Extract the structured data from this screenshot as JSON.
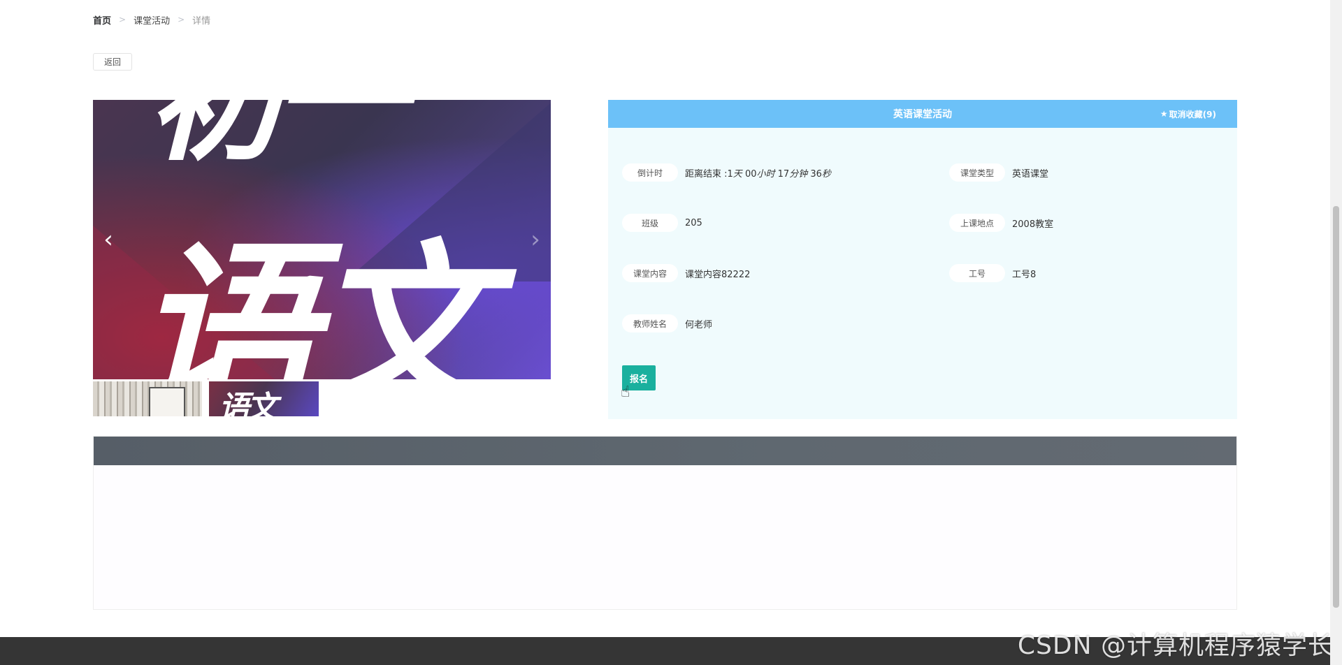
{
  "breadcrumb": {
    "home": "首页",
    "section": "课堂活动",
    "current": "详情",
    "separator": ">"
  },
  "back_label": "返回",
  "carousel": {
    "image_text_top": "初一",
    "image_text_main": "语文",
    "thumb_text": "语文",
    "prev_icon": "chevron-left-icon",
    "next_icon": "chevron-right-icon"
  },
  "detail": {
    "title": "英语课堂活动",
    "favorite_label": "取消收藏(9)",
    "favorite_icon": "star-icon",
    "countdown": {
      "label": "倒计时",
      "prefix": "距离结束 :1",
      "day_unit": "天",
      "hours": " 00",
      "hour_unit": "小时",
      "minutes": " 17",
      "minute_unit": "分钟",
      "seconds": " 36",
      "second_unit": "秒"
    },
    "course_type": {
      "label": "课堂类型",
      "value": "英语课堂"
    },
    "class": {
      "label": "班级",
      "value": "205"
    },
    "location": {
      "label": "上课地点",
      "value": "2008教室"
    },
    "content": {
      "label": "课堂内容",
      "value": "课堂内容82222"
    },
    "staff_no": {
      "label": "工号",
      "value": "工号8"
    },
    "teacher": {
      "label": "教师姓名",
      "value": "何老师"
    },
    "signup_label": "报名"
  },
  "watermark": "CSDN @计算机程序猿学长",
  "colors": {
    "header_blue": "#6cc1f8",
    "detail_bg": "#f0fbfd",
    "signup_green": "#1ab09e",
    "content_bar": "#5d656d",
    "footer": "#353535"
  }
}
